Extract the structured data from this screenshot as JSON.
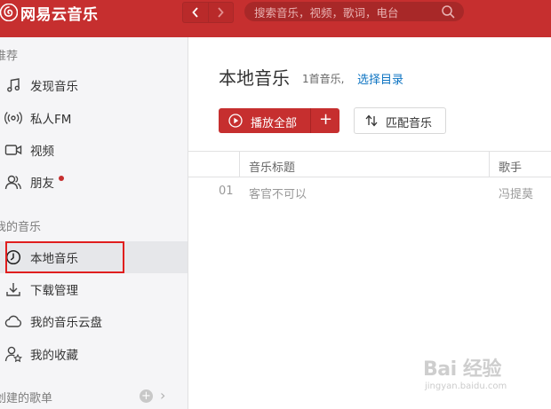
{
  "app": {
    "logo_text": "网易云音乐",
    "brand_color": "#c62f2f"
  },
  "topbar": {
    "back_icon": "chevron-left-icon",
    "forward_icon": "chevron-right-icon",
    "search_placeholder": "搜索音乐，视频，歌词，电台",
    "search_icon": "search-icon"
  },
  "sidebar": {
    "section_recommend": "推荐",
    "recommend_items": [
      {
        "label": "发现音乐",
        "icon": "music-note-icon"
      },
      {
        "label": "私人FM",
        "icon": "radio-icon"
      },
      {
        "label": "视频",
        "icon": "video-icon"
      },
      {
        "label": "朋友",
        "icon": "friends-icon"
      }
    ],
    "section_my_music": "我的音乐",
    "my_music_items": [
      {
        "label": "本地音乐",
        "icon": "clock-icon",
        "active": true
      },
      {
        "label": "下载管理",
        "icon": "download-icon"
      },
      {
        "label": "我的音乐云盘",
        "icon": "cloud-icon"
      },
      {
        "label": "我的收藏",
        "icon": "collection-icon"
      }
    ],
    "section_created_playlists": "创建的歌单"
  },
  "main": {
    "title": "本地音乐",
    "count": "1首音乐,",
    "choose_dir": "选择目录",
    "play_all_label": "播放全部",
    "add_label": "+",
    "match_label": "匹配音乐",
    "table": {
      "columns": [
        "音乐标题",
        "歌手"
      ],
      "rows": [
        {
          "index": "01",
          "title": "客官不可以",
          "artist": "冯提莫"
        }
      ]
    }
  },
  "watermark": {
    "text": "Bai 经验",
    "url_text": "jingyan.baidu.com"
  }
}
